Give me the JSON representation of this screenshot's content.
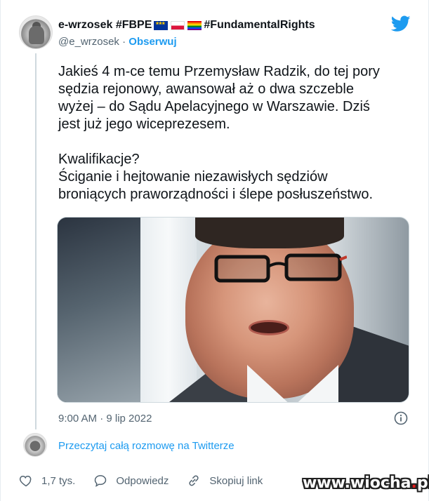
{
  "tweet": {
    "display_name": "e-wrzosek #FBPE",
    "display_name_suffix": "#FundamentalRights",
    "handle": "@e_wrzosek",
    "separator": "·",
    "follow_label": "Obserwuj",
    "paragraphs": [
      "Jakieś 4 m-ce temu Przemysław Radzik, do tej pory\nsędzia rejonowy, awansował aż o dwa szczeble\nwyżej – do Sądu Apelacyjnego w Warszawie. Dziś\njest już jego wiceprezesem.",
      "Kwalifikacje?\nŚciganie i hejtowanie niezawisłych sędziów\nbroniących praworządności i ślepe posłuszeństwo."
    ],
    "timestamp": "9:00 AM · 9 lip 2022",
    "read_conversation_label": "Przeczytaj całą rozmowę na Twitterze",
    "actions": {
      "likes": "1,7 tys.",
      "reply": "Odpowiedz",
      "copy_link": "Skopiuj link"
    }
  },
  "watermark": {
    "text_main": "www.wiocha",
    "text_dot": ".",
    "text_tld": "pl"
  },
  "colors": {
    "twitter_blue": "#1d9bf0",
    "text": "#0f1419",
    "muted": "#536471"
  },
  "icons": [
    "twitter-bird-icon",
    "info-icon",
    "heart-icon",
    "reply-icon",
    "link-icon"
  ]
}
